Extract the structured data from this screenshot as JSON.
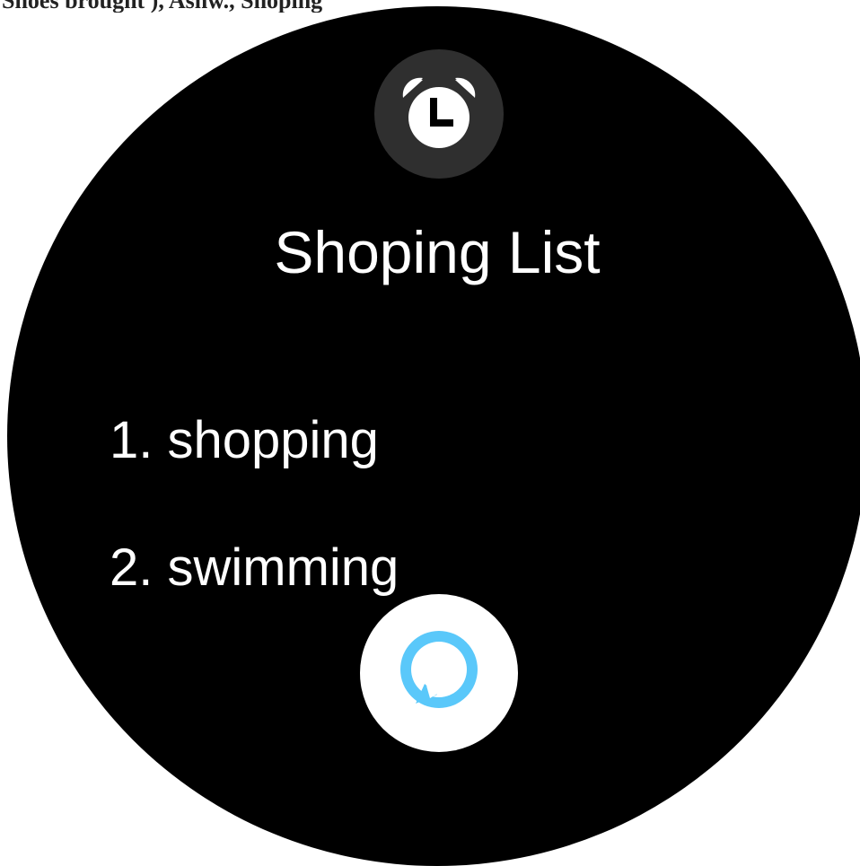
{
  "top_strip": {
    "text": "Shoes brought ), Asnw., Shoping"
  },
  "header": {
    "icon": "alarm-clock-icon",
    "icon_color": "#ffffff",
    "badge_color": "#2f2f2f"
  },
  "list": {
    "title": "Shoping List",
    "items": [
      {
        "label": "1. shopping"
      },
      {
        "label": "2. swimming"
      }
    ]
  },
  "assistant": {
    "icon": "alexa-ring-icon",
    "accent_color": "#5ac8fa"
  },
  "colors": {
    "background": "#000000",
    "text": "#ffffff"
  }
}
